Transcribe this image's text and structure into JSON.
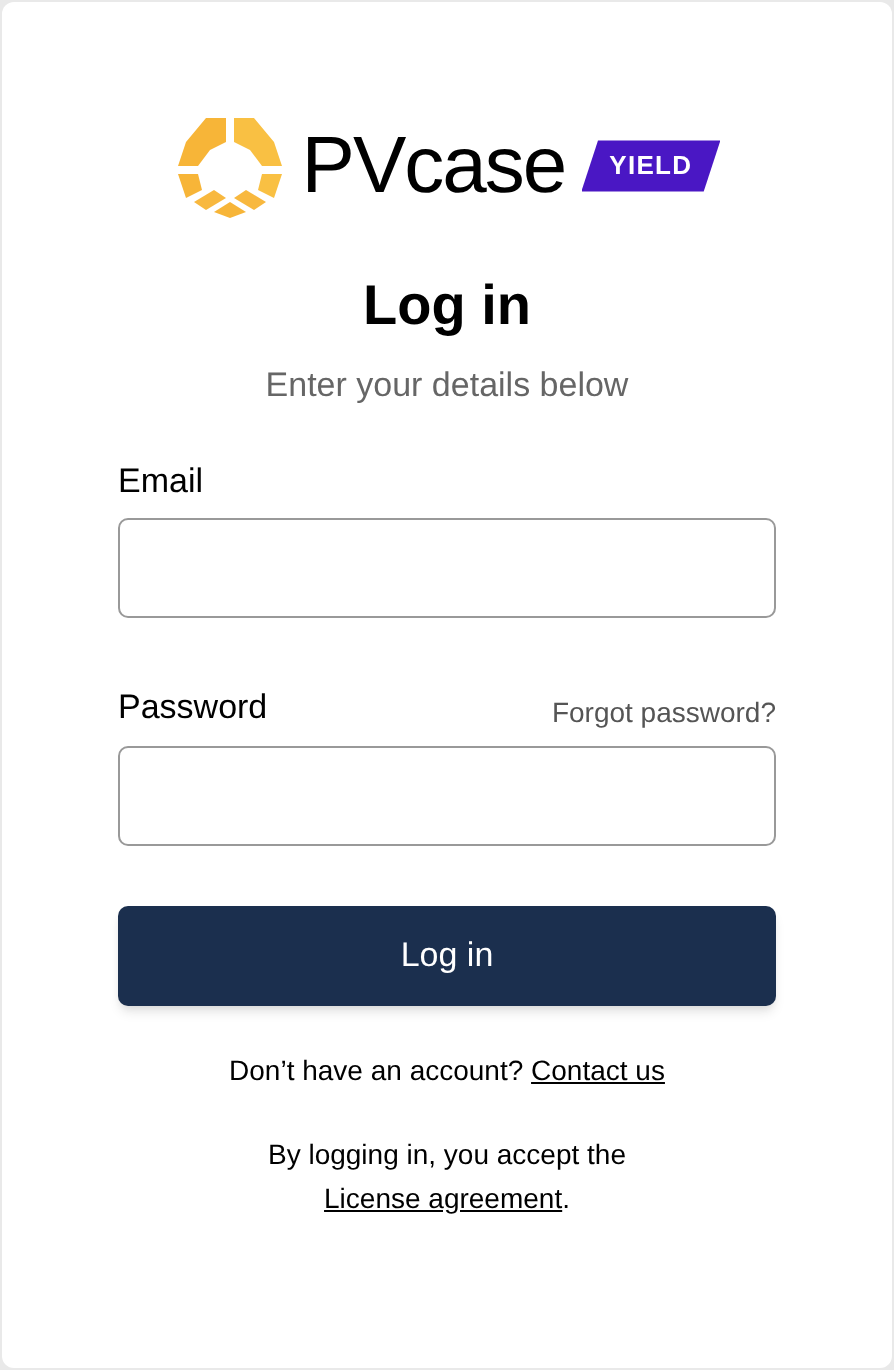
{
  "logo": {
    "wordmark": "PVcase",
    "badge": "YIELD"
  },
  "title": "Log in",
  "subtitle": "Enter your details below",
  "fields": [
    {
      "label": "Email"
    },
    {
      "label": "Password",
      "link": "Forgot password?"
    }
  ],
  "submit": "Log in",
  "signup": {
    "text": "Don’t have an account?",
    "link": "Contact us"
  },
  "license": {
    "text": "By logging in, you accept the",
    "link": "License agreement",
    "suffix": "."
  }
}
